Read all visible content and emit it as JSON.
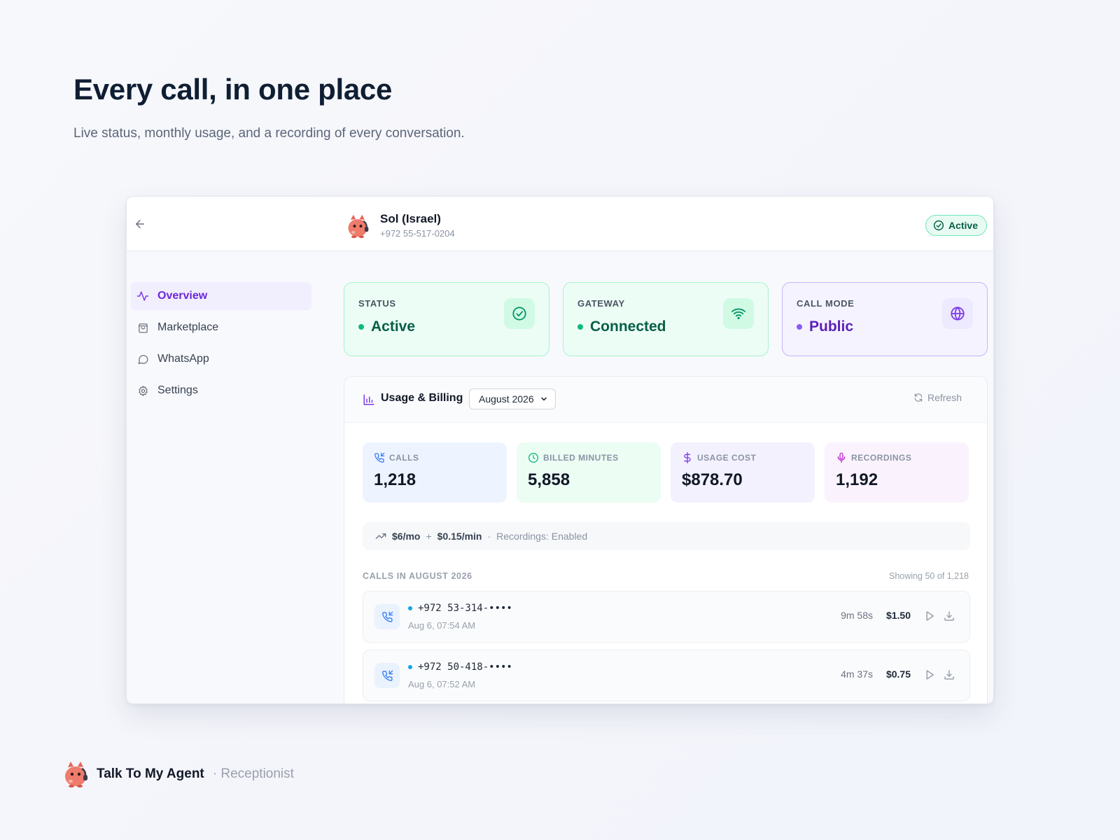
{
  "hero": {
    "title": "Every call, in one place",
    "subtitle": "Live status, monthly usage, and a recording of every conversation."
  },
  "header": {
    "agent_name": "Sol (Israel)",
    "agent_phone": "+972 55-517-0204",
    "status_badge": "Active"
  },
  "sidebar": {
    "items": [
      {
        "label": "Overview",
        "icon": "activity-icon",
        "active": true
      },
      {
        "label": "Marketplace",
        "icon": "shopping-bag-icon",
        "active": false
      },
      {
        "label": "WhatsApp",
        "icon": "message-circle-icon",
        "active": false
      },
      {
        "label": "Settings",
        "icon": "gear-icon",
        "active": false
      }
    ]
  },
  "status_cards": [
    {
      "label": "STATUS",
      "value": "Active",
      "icon": "check-circle-icon",
      "tone": "green"
    },
    {
      "label": "GATEWAY",
      "value": "Connected",
      "icon": "wifi-icon",
      "tone": "green"
    },
    {
      "label": "CALL MODE",
      "value": "Public",
      "icon": "globe-icon",
      "tone": "purple"
    }
  ],
  "billing": {
    "title": "Usage & Billing",
    "month": "August 2026",
    "refresh_label": "Refresh",
    "metrics": [
      {
        "label": "CALLS",
        "value": "1,218",
        "icon": "phone-incoming-icon",
        "color": "#3b82f6"
      },
      {
        "label": "BILLED MINUTES",
        "value": "5,858",
        "icon": "clock-icon",
        "color": "#10b981"
      },
      {
        "label": "USAGE COST",
        "value": "$878.70",
        "icon": "dollar-icon",
        "color": "#7c3aed"
      },
      {
        "label": "RECORDINGS",
        "value": "1,192",
        "icon": "mic-icon",
        "color": "#c026d3"
      }
    ],
    "pricing": {
      "monthly": "$6/mo",
      "plus": "+",
      "per_minute": "$0.15/min",
      "separator": "·",
      "recordings": "Recordings: Enabled"
    }
  },
  "calls": {
    "section_label": "CALLS IN AUGUST 2026",
    "count_label": "Showing 50 of 1,218",
    "rows": [
      {
        "number": "+972 53-314-••••",
        "time": "Aug 6, 07:54 AM",
        "duration": "9m 58s",
        "cost": "$1.50"
      },
      {
        "number": "+972 50-418-••••",
        "time": "Aug 6, 07:52 AM",
        "duration": "4m 37s",
        "cost": "$0.75"
      }
    ]
  },
  "footer": {
    "brand": "Talk To My Agent",
    "product": "· Receptionist"
  },
  "colors": {
    "accent_purple": "#6d28d9",
    "success_green": "#10b981",
    "heading_dark": "#0f1e33"
  }
}
